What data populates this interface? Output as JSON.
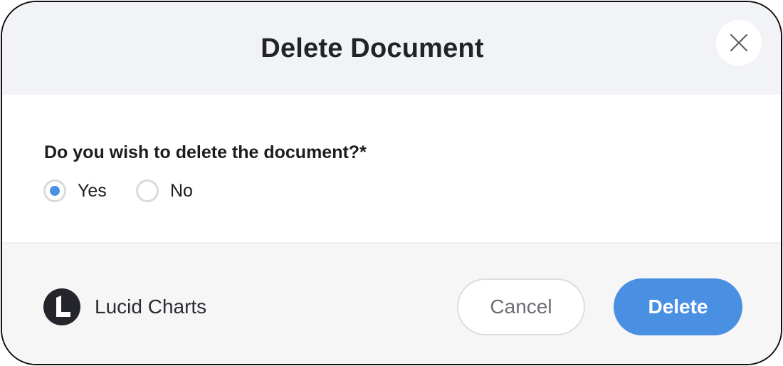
{
  "dialog": {
    "title": "Delete Document",
    "close_icon": "close-icon"
  },
  "form": {
    "question": "Do you wish to delete the document?*",
    "options": [
      {
        "label": "Yes",
        "selected": true
      },
      {
        "label": "No",
        "selected": false
      }
    ]
  },
  "footer": {
    "brand_name": "Lucid Charts",
    "brand_icon": "lucid-logo-icon",
    "cancel_label": "Cancel",
    "delete_label": "Delete"
  },
  "colors": {
    "accent": "#4a90e2",
    "header_bg": "#f2f3f6",
    "footer_bg": "#f6f6f7",
    "title_text": "#222326"
  }
}
